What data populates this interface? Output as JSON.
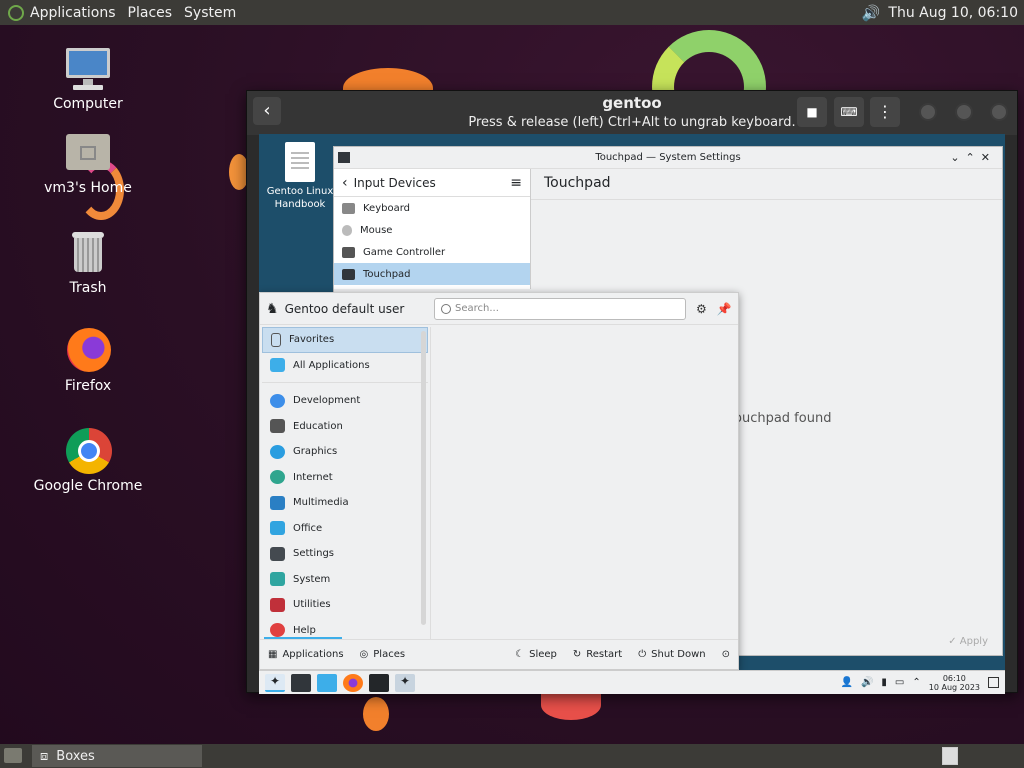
{
  "top_panel": {
    "menus": [
      "Applications",
      "Places",
      "System"
    ],
    "clock": "Thu Aug 10, 06:10"
  },
  "desktop_icons": [
    {
      "label": "Computer",
      "icon": "computer-icon"
    },
    {
      "label": "vm3's Home",
      "icon": "home-folder-icon"
    },
    {
      "label": "Trash",
      "icon": "trash-icon"
    },
    {
      "label": "Firefox",
      "icon": "firefox-icon"
    },
    {
      "label": "Google Chrome",
      "icon": "chrome-icon"
    }
  ],
  "boxes": {
    "title": "gentoo",
    "subtitle": "Press & release (left) Ctrl+Alt to ungrab keyboard.",
    "back_symbol": "‹"
  },
  "guest": {
    "desktop_icon_label": "Gentoo Linux Handbook",
    "settings": {
      "window_title": "Touchpad — System Settings",
      "back_label": "Input Devices",
      "items": [
        {
          "label": "Keyboard",
          "icon": "keyboard-icon"
        },
        {
          "label": "Mouse",
          "icon": "mouse-icon"
        },
        {
          "label": "Game Controller",
          "icon": "gamepad-icon"
        },
        {
          "label": "Touchpad",
          "icon": "touchpad-icon",
          "selected": true
        }
      ],
      "page_title": "Touchpad",
      "message": "ouchpad found",
      "apply_label": "Apply"
    },
    "launcher": {
      "user": "Gentoo default user",
      "search_placeholder": "Search...",
      "categories": [
        {
          "label": "Favorites",
          "color": "#e0e8f0",
          "selected": true
        },
        {
          "label": "All Applications",
          "color": "#3daee9"
        },
        {
          "label": "Development",
          "color": "#3d8ee9"
        },
        {
          "label": "Education",
          "color": "#555555"
        },
        {
          "label": "Graphics",
          "color": "#2a9de0"
        },
        {
          "label": "Internet",
          "color": "#2fa58e"
        },
        {
          "label": "Multimedia",
          "color": "#2a7fc4"
        },
        {
          "label": "Office",
          "color": "#31a4e0"
        },
        {
          "label": "Settings",
          "color": "#444a50"
        },
        {
          "label": "System",
          "color": "#2fa5a0"
        },
        {
          "label": "Utilities",
          "color": "#c0303a"
        },
        {
          "label": "Help",
          "color": "#e04040"
        }
      ],
      "bottom": {
        "applications": "Applications",
        "places": "Places",
        "sleep": "Sleep",
        "restart": "Restart",
        "shutdown": "Shut Down"
      }
    },
    "panel": {
      "time": "06:10",
      "date": "10 Aug 2023"
    }
  },
  "taskbar": {
    "task_label": "Boxes"
  }
}
